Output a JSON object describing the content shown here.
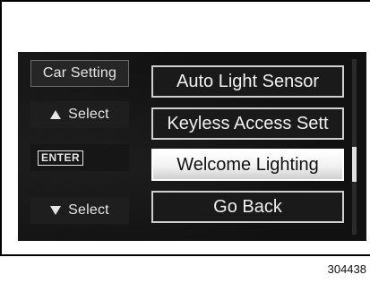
{
  "screen": {
    "left_controls": {
      "car_setting": "Car Setting",
      "select_up": "Select",
      "enter": "ENTER",
      "select_down": "Select"
    },
    "menu": {
      "items": [
        {
          "label": "Auto Light Sensor",
          "selected": false
        },
        {
          "label": "Keyless Access Sett",
          "selected": false
        },
        {
          "label": "Welcome Lighting",
          "selected": true
        },
        {
          "label": "Go Back",
          "selected": false
        }
      ]
    },
    "scrollbar": {
      "thumb_start_fraction": 0.5,
      "thumb_end_fraction": 0.7
    }
  },
  "figure": {
    "id": "304438"
  }
}
